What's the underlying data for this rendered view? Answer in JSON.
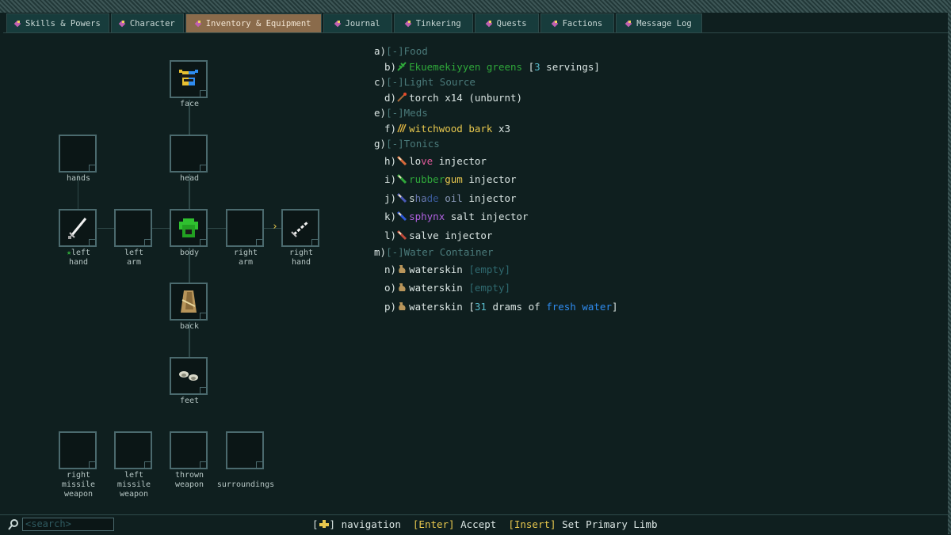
{
  "tabs": [
    {
      "label": "Skills & Powers",
      "active": false
    },
    {
      "label": "Character",
      "active": false
    },
    {
      "label": "Inventory & Equipment",
      "active": true
    },
    {
      "label": "Journal",
      "active": false
    },
    {
      "label": "Tinkering",
      "active": false
    },
    {
      "label": "Quests",
      "active": false
    },
    {
      "label": "Factions",
      "active": false
    },
    {
      "label": "Message Log",
      "active": false
    }
  ],
  "equipment": {
    "face": {
      "label": "face",
      "icon": "helmet-mask-icon"
    },
    "hands": {
      "label": "hands"
    },
    "head": {
      "label": "head"
    },
    "left_hand": {
      "star": "★",
      "label1": "left",
      "label2": "hand",
      "icon": "sword-icon"
    },
    "left_arm": {
      "label1": "left",
      "label2": "arm"
    },
    "body": {
      "label": "body",
      "icon": "green-armor-icon"
    },
    "right_arm": {
      "label1": "right",
      "label2": "arm"
    },
    "right_hand": {
      "label1": "right",
      "label2": "hand",
      "icon": "dagger-icon"
    },
    "back": {
      "label": "back",
      "icon": "cloak-icon"
    },
    "feet": {
      "label": "feet",
      "icon": "shoes-icon"
    },
    "right_missile": {
      "label1": "right",
      "label2": "missile",
      "label3": "weapon"
    },
    "left_missile": {
      "label1": "left",
      "label2": "missile",
      "label3": "weapon"
    },
    "thrown": {
      "label1": "thrown",
      "label2": "weapon"
    },
    "surroundings": {
      "label": "surroundings"
    },
    "arrow": "›"
  },
  "inventory": {
    "food": {
      "key": "a)",
      "toggle": "[-]",
      "name": "Food"
    },
    "greens": {
      "key": "b)",
      "name": "Ekuemekiyyen greens",
      "extra_open": "[",
      "count": "3",
      "extra_rest": " servings]",
      "icon": "herb-icon"
    },
    "light": {
      "key": "c)",
      "toggle": "[-]",
      "name": "Light Source"
    },
    "torch": {
      "key": "d)",
      "name": "torch x14 (unburnt)",
      "icon": "torch-icon"
    },
    "meds": {
      "key": "e)",
      "toggle": "[-]",
      "name": "Meds"
    },
    "bark": {
      "key": "f)",
      "name": "witchwood bark",
      "qty": " x3",
      "icon": "bark-icon"
    },
    "tonics": {
      "key": "g)",
      "toggle": "[-]",
      "name": "Tonics"
    },
    "love": {
      "key": "h)",
      "p1": "lo",
      "p2": "ve",
      "rest": " injector",
      "icon": "injector-icon"
    },
    "rubbergum": {
      "key": "i)",
      "p1": "rubber",
      "p2": "gum",
      "rest": " injector",
      "icon": "injector-icon"
    },
    "shade": {
      "key": "j)",
      "p1": "s",
      "p2": "ha",
      "p3": "de",
      "p4": " oil",
      "rest": " injector",
      "icon": "injector-icon"
    },
    "sphynx": {
      "key": "k)",
      "p1": "sphynx",
      "rest": " salt injector",
      "icon": "injector-icon"
    },
    "salve": {
      "key": "l)",
      "name": "salve injector",
      "icon": "injector-icon"
    },
    "water": {
      "key": "m)",
      "toggle": "[-]",
      "name": "Water Container"
    },
    "skin1": {
      "key": "n)",
      "name": "waterskin ",
      "ob": "[",
      "state": "empty",
      "cb": "]",
      "icon": "waterskin-icon"
    },
    "skin2": {
      "key": "o)",
      "name": "waterskin ",
      "ob": "[",
      "state": "empty",
      "cb": "]",
      "icon": "waterskin-icon"
    },
    "skin3": {
      "key": "p)",
      "name": "waterskin ",
      "ob": "[",
      "amt": "31",
      "mid": " drams of ",
      "fresh": "fresh water",
      "cb": "]",
      "icon": "waterskin-icon"
    }
  },
  "footer": {
    "search_placeholder": "<search>",
    "nav_bracket_open": "[",
    "nav_bracket_close": "]",
    "nav_label": " navigation  ",
    "enter_key": "[Enter]",
    "enter_label": " Accept  ",
    "insert_key": "[Insert]",
    "insert_label": " Set Primary Limb"
  },
  "colors": {
    "accent_tab": "#8a6b4b",
    "background": "#0f1f1f",
    "category": "#4a7a7a",
    "highlight": "#e8c84e"
  }
}
